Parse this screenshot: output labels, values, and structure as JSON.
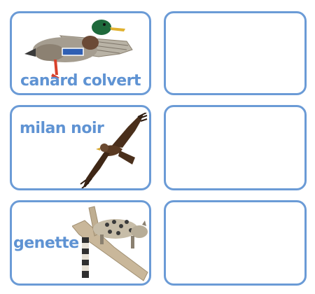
{
  "cards": [
    {
      "label": "canard colvert",
      "image": "mallard-duck"
    },
    {
      "label": "milan noir",
      "image": "black-kite"
    },
    {
      "label": "genette",
      "image": "genet"
    }
  ],
  "empty_slots": 3,
  "colors": {
    "border": "#6b9bd6",
    "label": "#5f93d3"
  }
}
